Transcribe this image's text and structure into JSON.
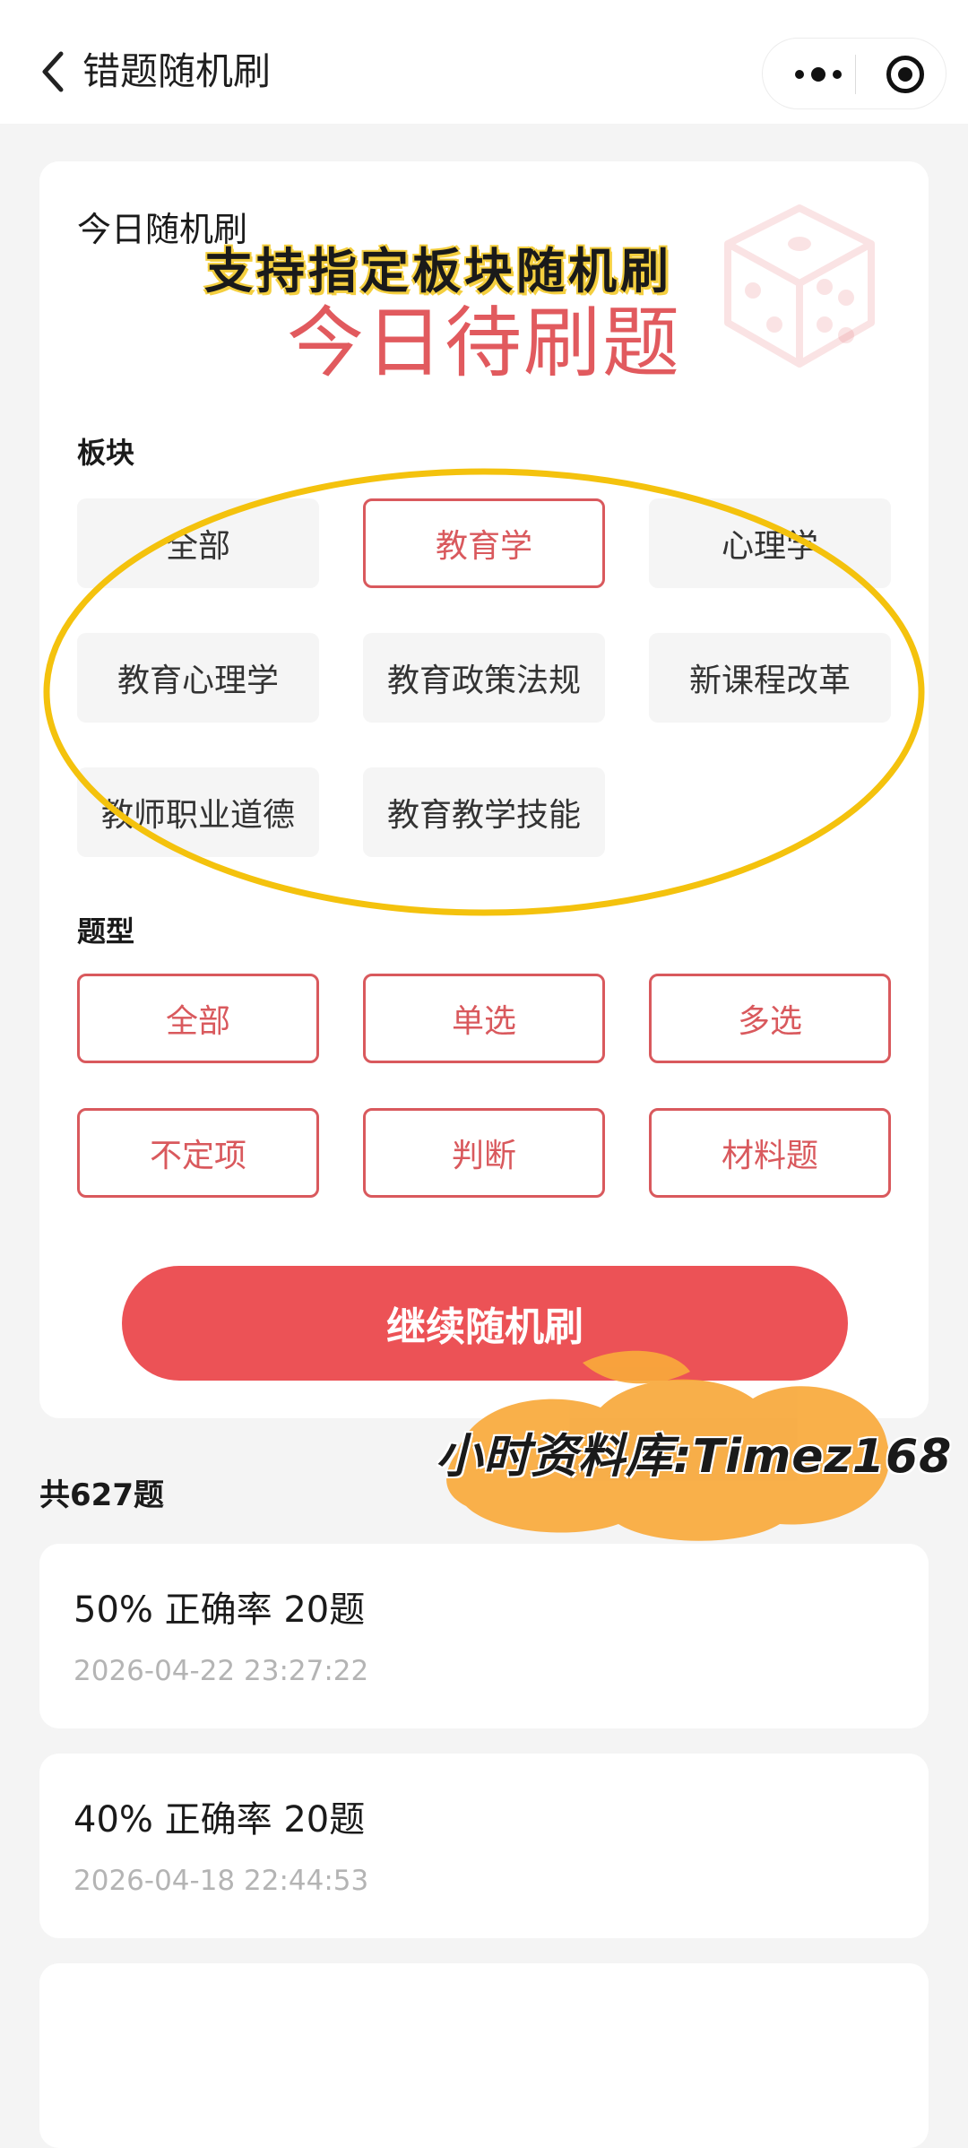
{
  "nav": {
    "title": "错题随机刷"
  },
  "card": {
    "title": "今日随机刷",
    "headline": "今日待刷题",
    "overlay_caption": "支持指定板块随机刷",
    "section_label": "板块",
    "sections": [
      {
        "label": "全部",
        "selected": false
      },
      {
        "label": "教育学",
        "selected": true
      },
      {
        "label": "心理学",
        "selected": false
      },
      {
        "label": "教育心理学",
        "selected": false
      },
      {
        "label": "教育政策法规",
        "selected": false
      },
      {
        "label": "新课程改革",
        "selected": false
      },
      {
        "label": "教师职业道德",
        "selected": false
      },
      {
        "label": "教育教学技能",
        "selected": false
      }
    ],
    "type_label": "题型",
    "types": [
      {
        "label": "全部",
        "selected": true
      },
      {
        "label": "单选",
        "selected": true
      },
      {
        "label": "多选",
        "selected": true
      },
      {
        "label": "不定项",
        "selected": true
      },
      {
        "label": "判断",
        "selected": true
      },
      {
        "label": "材料题",
        "selected": true
      }
    ],
    "action_label": "继续随机刷"
  },
  "watermark": "小时资料库:Timez168",
  "summary": {
    "total": "共627题"
  },
  "records": [
    {
      "result": "50% 正确率 20题",
      "time": "2026-04-22 23:27:22"
    },
    {
      "result": "40% 正确率 20题",
      "time": "2026-04-18 22:44:53"
    }
  ],
  "colors": {
    "accent": "#ec5256",
    "outline_red": "#d9595d",
    "highlight_yellow": "#f4c20d",
    "scribble_orange": "#f8a93b"
  }
}
